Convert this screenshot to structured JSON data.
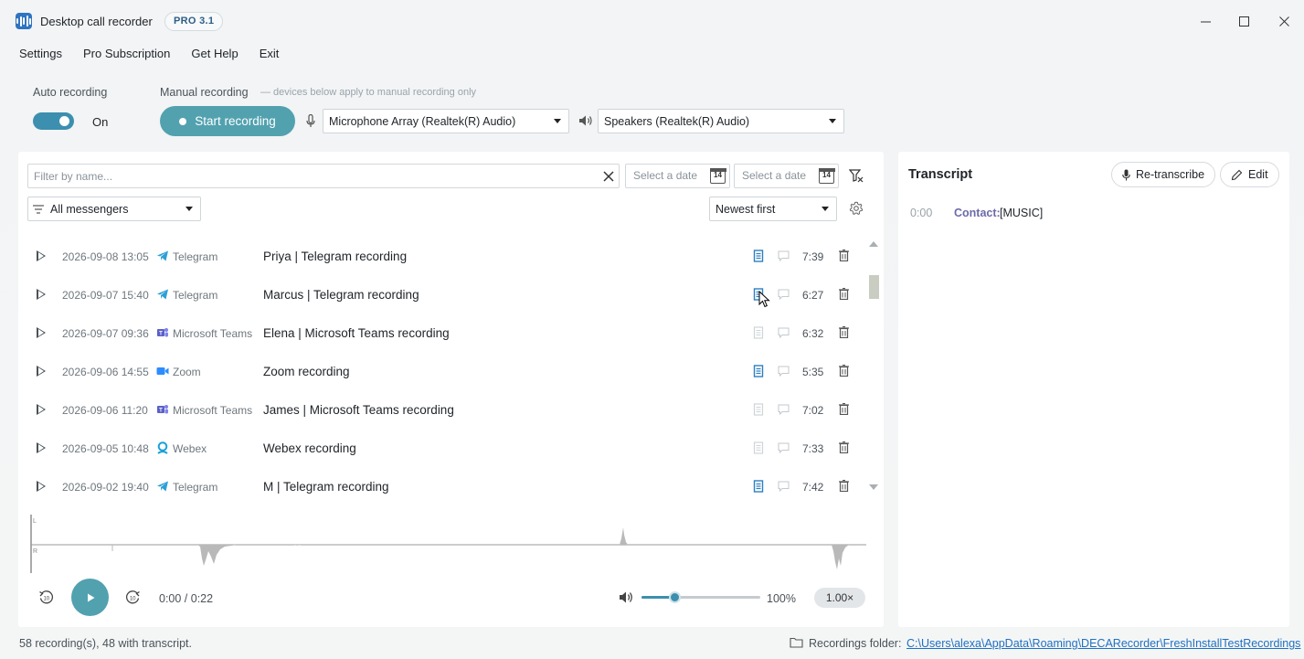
{
  "app": {
    "title": "Desktop call recorder",
    "version_badge": "PRO 3.1",
    "accent_color": "#52a1af"
  },
  "menu": [
    "Settings",
    "Pro Subscription",
    "Get Help",
    "Exit"
  ],
  "auto_recording": {
    "label": "Auto recording",
    "toggle_state": "On"
  },
  "manual_recording": {
    "label": "Manual recording",
    "hint": "— devices below apply to manual recording only",
    "start_button": "Start recording",
    "microphone": "Microphone Array (Realtek(R) Audio)",
    "speakers": "Speakers (Realtek(R) Audio)"
  },
  "filters": {
    "name_placeholder": "Filter by name...",
    "date_from_placeholder": "Select a date",
    "date_to_placeholder": "Select a date",
    "calendar_day": "14",
    "messenger_filter": "All messengers",
    "sort": "Newest first"
  },
  "recordings": [
    {
      "date": "2026-09-08 13:05",
      "messenger": "Telegram",
      "icon": "telegram-icon",
      "title": "Priya | Telegram recording",
      "has_transcript": true,
      "duration": "7:39"
    },
    {
      "date": "2026-09-07 15:40",
      "messenger": "Telegram",
      "icon": "telegram-icon",
      "title": "Marcus | Telegram recording",
      "has_transcript": true,
      "duration": "6:27"
    },
    {
      "date": "2026-09-07 09:36",
      "messenger": "Microsoft Teams",
      "icon": "teams-icon",
      "title": "Elena | Microsoft Teams recording",
      "has_transcript": false,
      "duration": "6:32"
    },
    {
      "date": "2026-09-06 14:55",
      "messenger": "Zoom",
      "icon": "zoom-icon",
      "title": "Zoom recording",
      "has_transcript": true,
      "duration": "5:35"
    },
    {
      "date": "2026-09-06 11:20",
      "messenger": "Microsoft Teams",
      "icon": "teams-icon",
      "title": "James | Microsoft Teams recording",
      "has_transcript": false,
      "duration": "7:02"
    },
    {
      "date": "2026-09-05 10:48",
      "messenger": "Webex",
      "icon": "webex-icon",
      "title": "Webex recording",
      "has_transcript": false,
      "duration": "7:33"
    },
    {
      "date": "2026-09-02 19:40",
      "messenger": "Telegram",
      "icon": "telegram-icon",
      "title": "M | Telegram recording",
      "has_transcript": true,
      "duration": "7:42"
    }
  ],
  "waveform": {
    "left_label": "L",
    "right_label": "R"
  },
  "player": {
    "time": "0:00 / 0:22",
    "volume_label": "100%",
    "volume_level": 0.28,
    "speed": "1.00×"
  },
  "status": {
    "summary": "58 recording(s), 48 with transcript.",
    "folder_label": "Recordings folder:",
    "folder_path": "C:\\Users\\alexa\\AppData\\Roaming\\DECARecorder\\FreshInstallTestRecordings"
  },
  "transcript": {
    "title": "Transcript",
    "retranscribe_button": "Re-transcribe",
    "edit_button": "Edit",
    "entries": [
      {
        "time": "0:00",
        "speaker": "Contact:",
        "text": "[MUSIC]"
      }
    ]
  }
}
